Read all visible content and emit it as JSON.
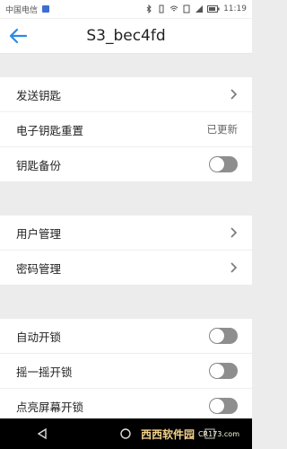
{
  "status_bar": {
    "carrier": "中国电信",
    "time": "11:19",
    "battery_icon": "battery-icon",
    "wifi_icon": "wifi-icon",
    "bluetooth_icon": "bluetooth-icon",
    "signal_icon": "signal-icon"
  },
  "header": {
    "title": "S3_bec4fd",
    "back_icon": "back-arrow-icon",
    "accent_color": "#2b8ae6"
  },
  "section1": {
    "items": [
      {
        "label": "发送钥匙",
        "type": "chevron"
      },
      {
        "label": "电子钥匙重置",
        "type": "value",
        "value": "已更新"
      },
      {
        "label": "钥匙备份",
        "type": "toggle",
        "on": false
      }
    ]
  },
  "section2": {
    "items": [
      {
        "label": "用户管理",
        "type": "chevron"
      },
      {
        "label": "密码管理",
        "type": "chevron"
      }
    ]
  },
  "section3": {
    "items": [
      {
        "label": "自动开锁",
        "type": "toggle",
        "on": false
      },
      {
        "label": "摇一摇开锁",
        "type": "toggle",
        "on": false
      },
      {
        "label": "点亮屏幕开锁",
        "type": "toggle",
        "on": false
      }
    ]
  },
  "watermark": {
    "text": "西西软件园",
    "sub": "CR173.com"
  }
}
